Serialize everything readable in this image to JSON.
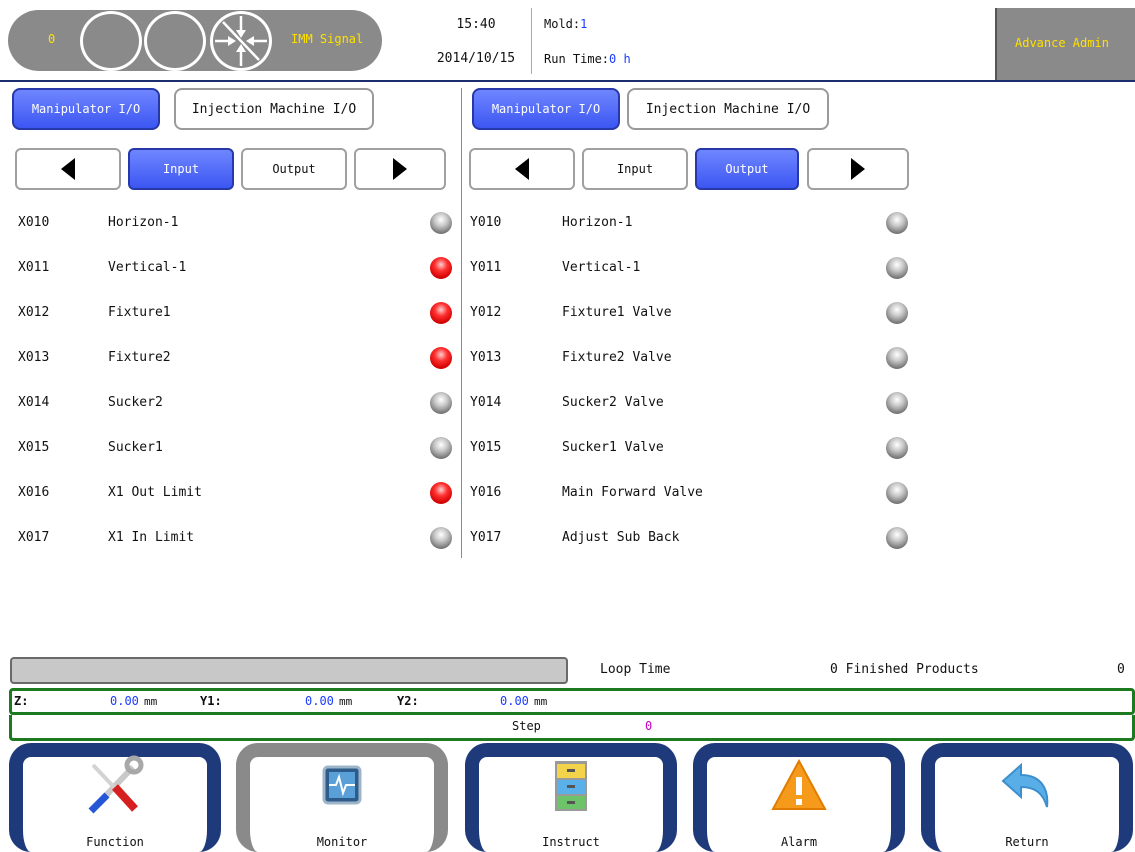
{
  "header": {
    "imm_count": "0",
    "imm_label": "IMM Signal",
    "time": "15:40",
    "date": "2014/10/15",
    "mold_label": "Mold:",
    "mold_value": "1",
    "run_time_label": "Run Time:",
    "run_time_value": "0 h",
    "user": "Advance Admin"
  },
  "left_panel": {
    "tabs": [
      "Manipulator I/O",
      "Injection Machine I/O"
    ],
    "active_tab": "Manipulator I/O",
    "io_buttons": [
      "Input",
      "Output"
    ],
    "active_io": "Input",
    "rows": [
      {
        "code": "X010",
        "name": "Horizon-1",
        "state": "off"
      },
      {
        "code": "X011",
        "name": "Vertical-1",
        "state": "on"
      },
      {
        "code": "X012",
        "name": "Fixture1",
        "state": "on"
      },
      {
        "code": "X013",
        "name": "Fixture2",
        "state": "on"
      },
      {
        "code": "X014",
        "name": "Sucker2",
        "state": "off"
      },
      {
        "code": "X015",
        "name": "Sucker1",
        "state": "off"
      },
      {
        "code": "X016",
        "name": "X1 Out Limit",
        "state": "on"
      },
      {
        "code": "X017",
        "name": "X1 In Limit",
        "state": "off"
      }
    ]
  },
  "right_panel": {
    "tabs": [
      "Manipulator I/O",
      "Injection Machine I/O"
    ],
    "active_tab": "Manipulator I/O",
    "io_buttons": [
      "Input",
      "Output"
    ],
    "active_io": "Output",
    "rows": [
      {
        "code": "Y010",
        "name": "Horizon-1",
        "state": "off"
      },
      {
        "code": "Y011",
        "name": "Vertical-1",
        "state": "off"
      },
      {
        "code": "Y012",
        "name": "Fixture1 Valve",
        "state": "off"
      },
      {
        "code": "Y013",
        "name": "Fixture2 Valve",
        "state": "off"
      },
      {
        "code": "Y014",
        "name": "Sucker2 Valve",
        "state": "off"
      },
      {
        "code": "Y015",
        "name": "Sucker1 Valve",
        "state": "off"
      },
      {
        "code": "Y016",
        "name": "Main Forward Valve",
        "state": "off"
      },
      {
        "code": "Y017",
        "name": "Adjust Sub Back",
        "state": "off"
      }
    ]
  },
  "status": {
    "loop_time_label": "Loop Time",
    "finished_label": "0 Finished Products",
    "finished_value": "0",
    "axes": [
      {
        "label": "Z:",
        "value": "0.00",
        "unit": "mm"
      },
      {
        "label": "Y1:",
        "value": "0.00",
        "unit": "mm"
      },
      {
        "label": "Y2:",
        "value": "0.00",
        "unit": "mm"
      }
    ],
    "step_label": "Step",
    "step_value": "0"
  },
  "nav": [
    {
      "label": "Function",
      "icon": "tools-icon"
    },
    {
      "label": "Monitor",
      "icon": "monitor-icon"
    },
    {
      "label": "Instruct",
      "icon": "file-cabinet-icon"
    },
    {
      "label": "Alarm",
      "icon": "warning-icon"
    },
    {
      "label": "Return",
      "icon": "return-arrow-icon"
    }
  ],
  "colors": {
    "accent_blue": "#3c56f2",
    "nav_frame": "#1f3a7a",
    "led_on": "#ff3030",
    "status_border": "#1e7a1e",
    "header_yellow": "#ffe000"
  }
}
